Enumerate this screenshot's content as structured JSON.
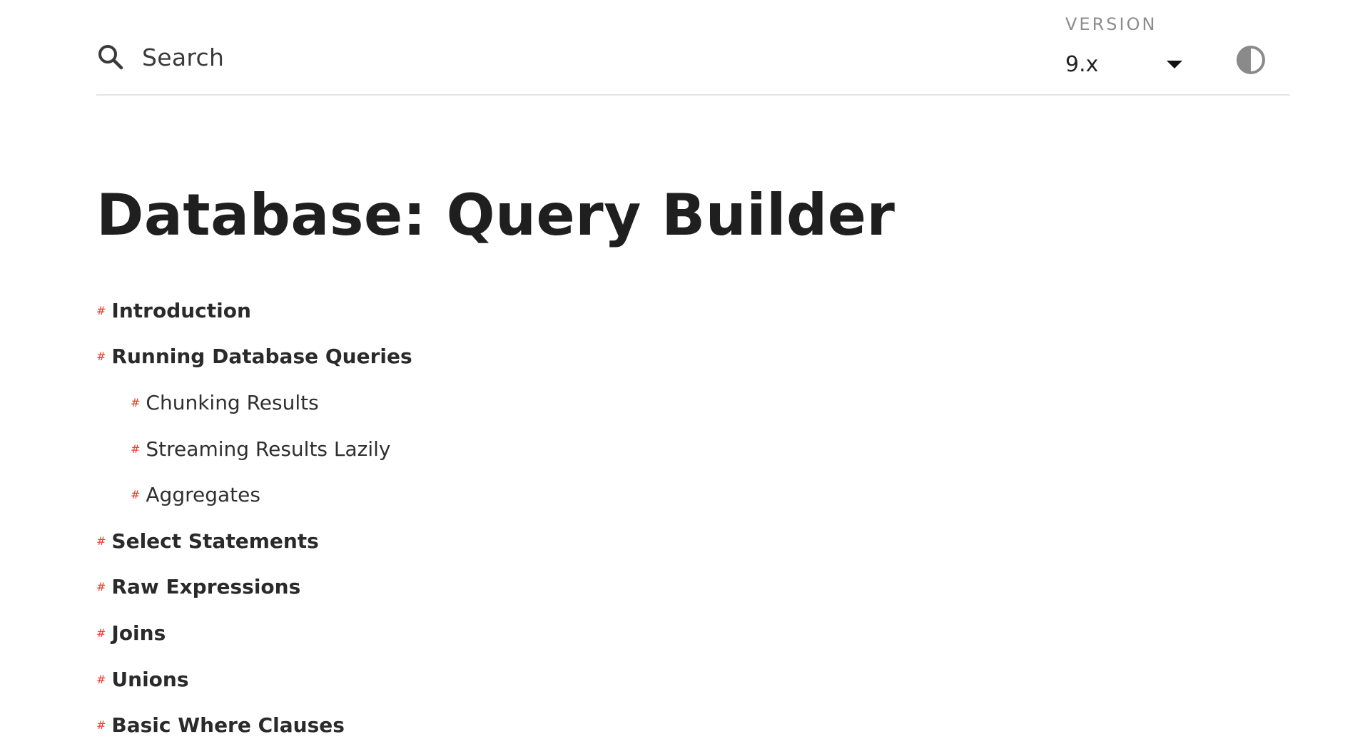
{
  "header": {
    "search": {
      "placeholder": "Search",
      "icon": "search-icon"
    },
    "version": {
      "label": "VERSION",
      "selected": "9.x",
      "icon": "caret-down-icon"
    },
    "theme_toggle": {
      "icon": "half-circle-contrast-icon"
    }
  },
  "page": {
    "title": "Database: Query Builder"
  },
  "toc": {
    "marker": "#",
    "items": [
      {
        "label": "Introduction",
        "level": 1
      },
      {
        "label": "Running Database Queries",
        "level": 1
      },
      {
        "label": "Chunking Results",
        "level": 2
      },
      {
        "label": "Streaming Results Lazily",
        "level": 2
      },
      {
        "label": "Aggregates",
        "level": 2
      },
      {
        "label": "Select Statements",
        "level": 1
      },
      {
        "label": "Raw Expressions",
        "level": 1
      },
      {
        "label": "Joins",
        "level": 1
      },
      {
        "label": "Unions",
        "level": 1
      },
      {
        "label": "Basic Where Clauses",
        "level": 1
      }
    ]
  },
  "colors": {
    "accent": "#ef3b2d",
    "text": "#2a2a2a",
    "muted": "#8c8c8c",
    "divider": "#e5e5e5"
  }
}
